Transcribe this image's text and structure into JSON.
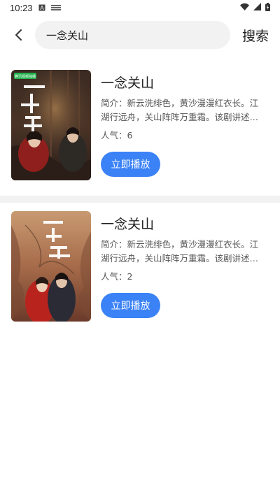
{
  "status_bar": {
    "time": "10:23",
    "icons": [
      "a-icon",
      "notification-icon",
      "wifi-icon",
      "signal-icon",
      "battery-icon"
    ]
  },
  "header": {
    "search_value": "一念关山",
    "search_button": "搜索",
    "back_icon": "back-arrow-icon"
  },
  "results": [
    {
      "title": "一念关山",
      "description": "简介：新云洗绯色，黄沙漫漫红衣长。江湖行远舟，关山阵阵万重霜。该剧讲述…",
      "popularity": "人气：6",
      "play_label": "立即播放",
      "poster_badge": "腾讯视频独播",
      "poster_title": "一念关山"
    },
    {
      "title": "一念关山",
      "description": "简介：新云洗绯色，黄沙漫漫红衣长。江湖行远舟，关山阵阵万重霜。该剧讲述…",
      "popularity": "人气：2",
      "play_label": "立即播放",
      "poster_title": "一念关山"
    }
  ],
  "colors": {
    "accent": "#3b82f6",
    "search_bg": "#f2f2f2",
    "divider": "#f2f2f2"
  }
}
